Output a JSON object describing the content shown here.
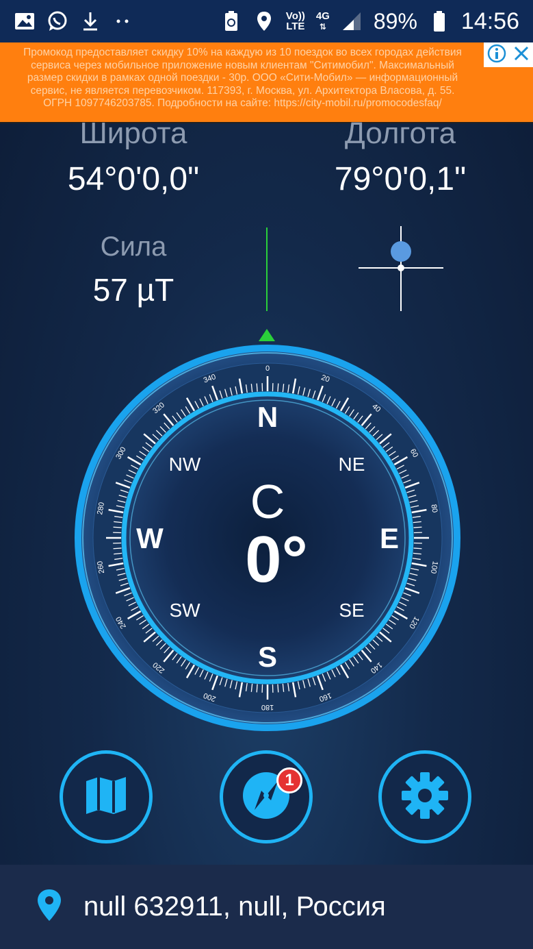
{
  "status_bar": {
    "volte_label_top": "Vo))",
    "volte_label_bottom": "LTE",
    "network_label": "4G",
    "battery_percent": "89%",
    "time": "14:56",
    "icons": [
      "image-icon",
      "whatsapp-icon",
      "download-icon",
      "more-dots-icon",
      "battery-saver-icon",
      "location-icon",
      "signal-icon",
      "battery-icon"
    ]
  },
  "ad": {
    "text": "Промокод предоставляет скидку 10% на каждую из 10 поездок во всех городах действия сервиса через мобильное приложение новым клиентам \"Ситимобил\". Максимальный размер скидки в рамках одной поездки - 30р. ООО «Сити-Мобил» — информационный сервис, не является перевозчиком. 117393, г. Москва, ул. Архитектора Власова, д. 55. ОГРН 1097746203785. Подробности на сайте: https://city-mobil.ru/promocodesfaq/",
    "info_icon": "info-icon",
    "close_icon": "close-icon"
  },
  "coords": {
    "latitude_label": "Широта",
    "latitude_value": "54°0'0,0\"",
    "longitude_label": "Долгота",
    "longitude_value": "79°0'0,1\""
  },
  "magnetic": {
    "label": "Сила",
    "value": "57 µT"
  },
  "compass": {
    "heading_letter": "С",
    "heading_degrees": "0°",
    "cardinals": [
      "N",
      "NE",
      "E",
      "SE",
      "S",
      "SW",
      "W",
      "NW"
    ],
    "degree_labels": [
      "0",
      "20",
      "40",
      "60",
      "80",
      "100",
      "120",
      "140",
      "160",
      "180",
      "200",
      "220",
      "240",
      "260",
      "280",
      "300",
      "320",
      "340"
    ],
    "accent_color": "#1fb4f5",
    "north_marker_color": "#2ad03a"
  },
  "nav": {
    "map_icon": "map-icon",
    "compass_icon": "compass-icon",
    "compass_badge": "1",
    "settings_icon": "gear-icon"
  },
  "address": {
    "icon": "location-pin-icon",
    "text": "null 632911, null, Россия"
  }
}
